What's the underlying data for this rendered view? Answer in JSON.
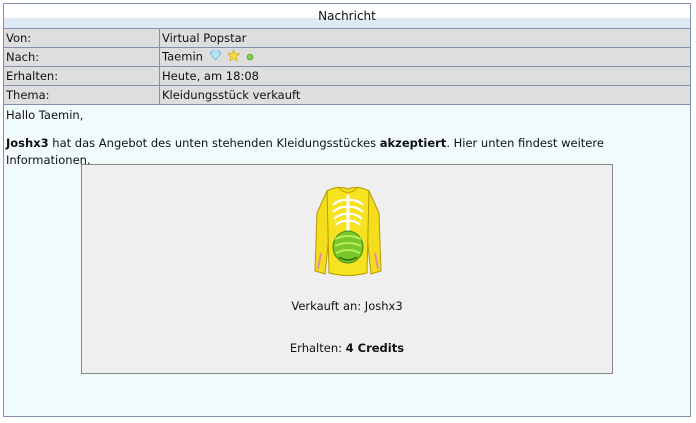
{
  "title": "Nachricht",
  "meta": [
    {
      "key": "Von:",
      "value": "Virtual Popstar"
    },
    {
      "key": "Nach:",
      "value": "Taemin",
      "icons": [
        "diamond-icon",
        "star-icon",
        "green-dot-icon"
      ]
    },
    {
      "key": "Erhalten:",
      "value": "Heute, am 18:08"
    },
    {
      "key": "Thema:",
      "value": "Kleidungsstück verkauft"
    }
  ],
  "greeting": "Hallo Taemin,",
  "message": {
    "buyer": "Joshx3",
    "text1": " hat das Angebot des unten stehenden Kleidungsstückes ",
    "accepted": "akzeptiert",
    "text2": ". Hier unten findest weitere Informationen."
  },
  "item": {
    "image": "yellow-skeleton-shirt-image",
    "sold_to_label": "Verkauft an: Joshx3",
    "received_label": "Erhalten: ",
    "received_value": "4 Credits"
  },
  "colors": {
    "border": "#8190b0",
    "meta_bg": "#dedede",
    "body_bg": "#f1fbfb",
    "item_bg": "#efefef"
  }
}
